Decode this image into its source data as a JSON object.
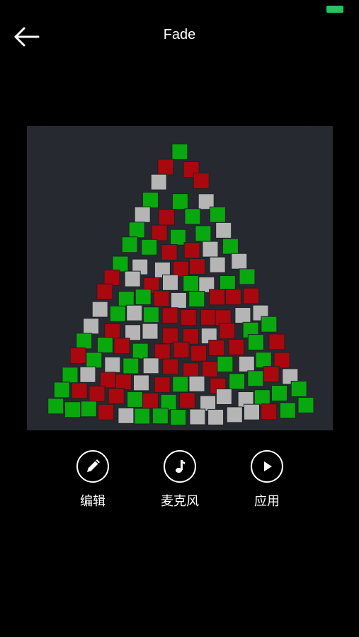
{
  "header": {
    "title": "Fade",
    "back_icon": "arrow-left-icon",
    "battery_color": "#22c55e"
  },
  "preview": {
    "background": "#262a30",
    "colors": {
      "green": "#08a80e",
      "red": "#a8080e",
      "gray": "#b5b5b5"
    }
  },
  "actions": [
    {
      "label": "编辑",
      "icon": "pencil-icon"
    },
    {
      "label": "麦克风",
      "icon": "music-note-icon"
    },
    {
      "label": "应用",
      "icon": "play-icon"
    }
  ]
}
